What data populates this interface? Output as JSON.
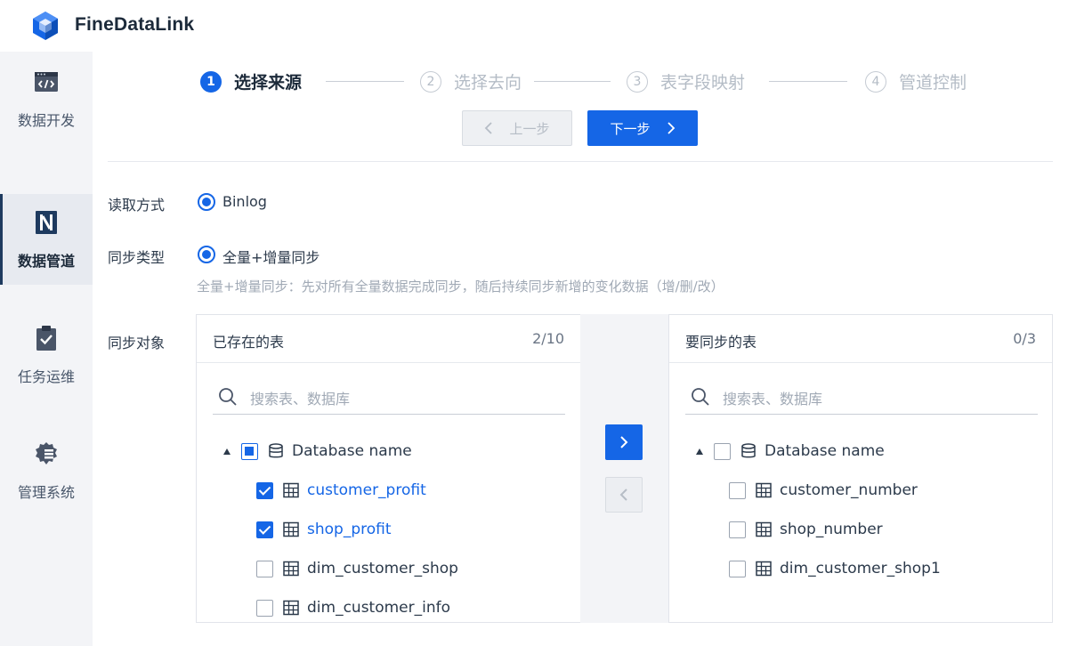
{
  "app": {
    "title": "FineDataLink"
  },
  "sidebar": {
    "items": [
      {
        "label": "数据开发",
        "icon": "code-window-icon"
      },
      {
        "label": "数据管道",
        "icon": "pipeline-icon",
        "active": true
      },
      {
        "label": "任务运维",
        "icon": "clipboard-check-icon"
      },
      {
        "label": "管理系统",
        "icon": "gear-icon"
      }
    ]
  },
  "steps": [
    {
      "num": "1",
      "label": "选择来源",
      "active": true
    },
    {
      "num": "2",
      "label": "选择去向"
    },
    {
      "num": "3",
      "label": "表字段映射"
    },
    {
      "num": "4",
      "label": "管道控制"
    }
  ],
  "buttons": {
    "prev": "上一步",
    "next": "下一步"
  },
  "form": {
    "read_mode_label": "读取方式",
    "read_mode_value": "Binlog",
    "sync_type_label": "同步类型",
    "sync_type_value": "全量+增量同步",
    "sync_type_hint": "全量+增量同步：先对所有全量数据完成同步，随后持续同步新增的变化数据（增/删/改）",
    "sync_object_label": "同步对象"
  },
  "transfer": {
    "left": {
      "title": "已存在的表",
      "count": "2/10",
      "search_placeholder": "搜索表、数据库",
      "database": "Database name",
      "tables": [
        {
          "name": "customer_profit",
          "checked": true
        },
        {
          "name": "shop_profit",
          "checked": true
        },
        {
          "name": "dim_customer_shop",
          "checked": false
        },
        {
          "name": "dim_customer_info",
          "checked": false
        }
      ]
    },
    "right": {
      "title": "要同步的表",
      "count": "0/3",
      "search_placeholder": "搜索表、数据库",
      "database": "Database name",
      "tables": [
        {
          "name": "customer_number",
          "checked": false
        },
        {
          "name": "shop_number",
          "checked": false
        },
        {
          "name": "dim_customer_shop1",
          "checked": false
        }
      ]
    }
  },
  "colors": {
    "accent": "#1566e6",
    "sidebar_bg": "#f3f4f7",
    "text": "#2c3a4b"
  }
}
